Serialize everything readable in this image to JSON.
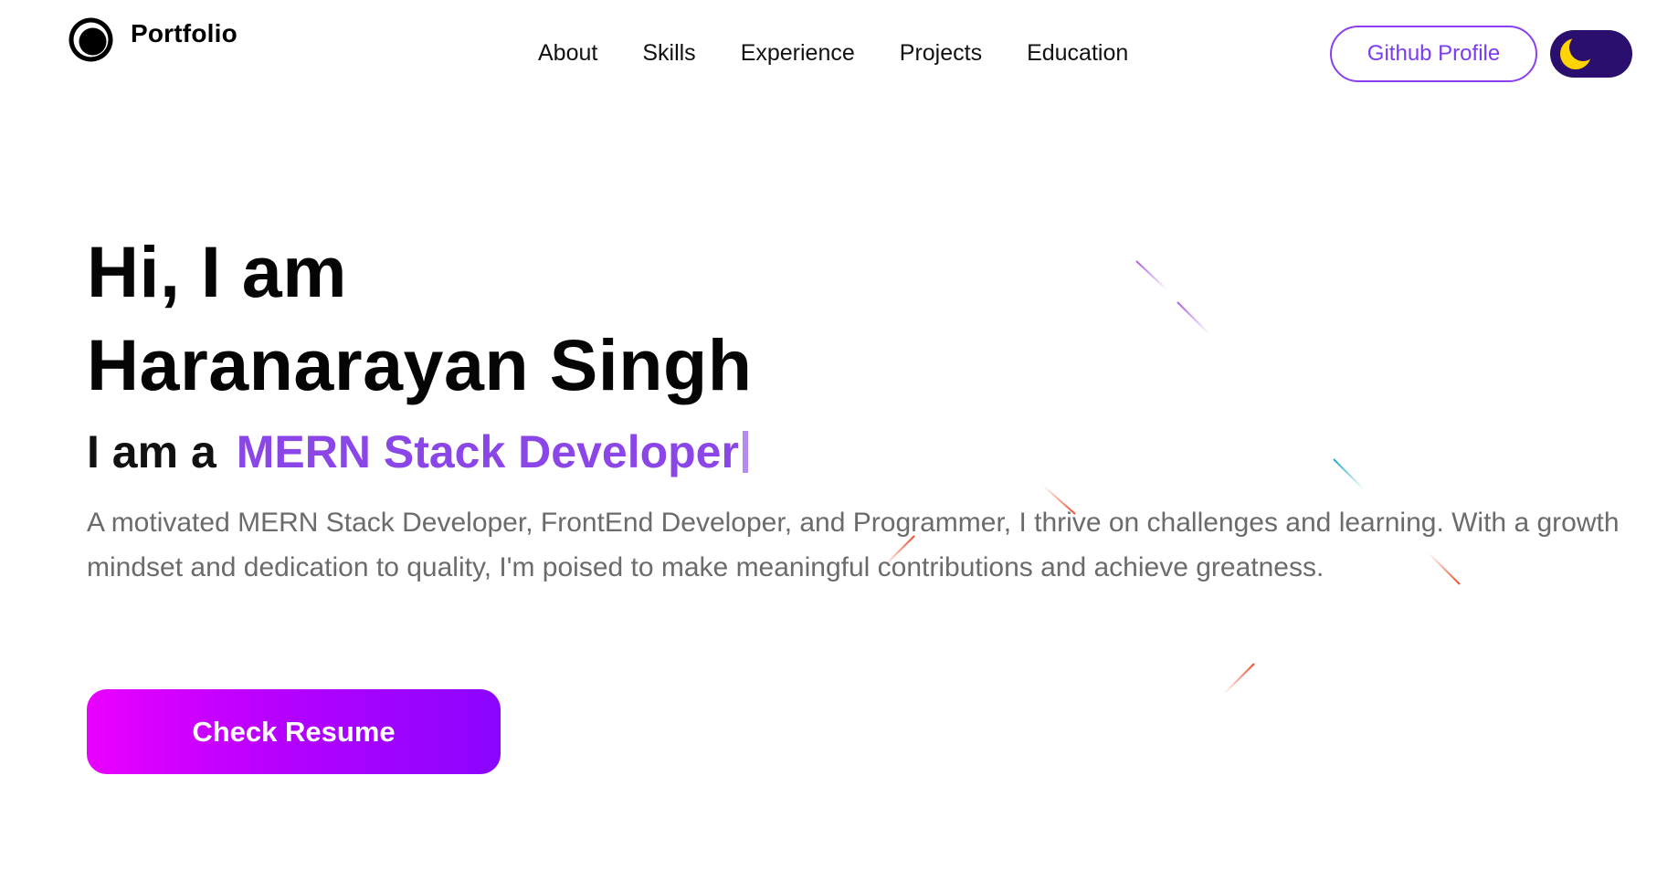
{
  "nav": {
    "logo_text": "Portfolio",
    "links": [
      "About",
      "Skills",
      "Experience",
      "Projects",
      "Education"
    ],
    "github_label": "Github Profile",
    "theme_toggle_icon": "moon-icon"
  },
  "hero": {
    "greeting": "Hi, I am",
    "name": "Haranarayan Singh",
    "role_prefix": "I am a",
    "role": "MERN Stack Developer",
    "description": "A motivated MERN Stack Developer, FrontEnd Developer, and Programmer, I thrive on challenges and learning. With a growth mindset and dedication to quality, I'm poised to make meaningful contributions and achieve greatness.",
    "resume_label": "Check Resume"
  },
  "colors": {
    "accent": "#8b46e8",
    "toggle_bg": "#2a0f6e",
    "moon": "#ffd400",
    "button_gradient_start": "#ea00ff",
    "button_gradient_end": "#8a05ff"
  }
}
